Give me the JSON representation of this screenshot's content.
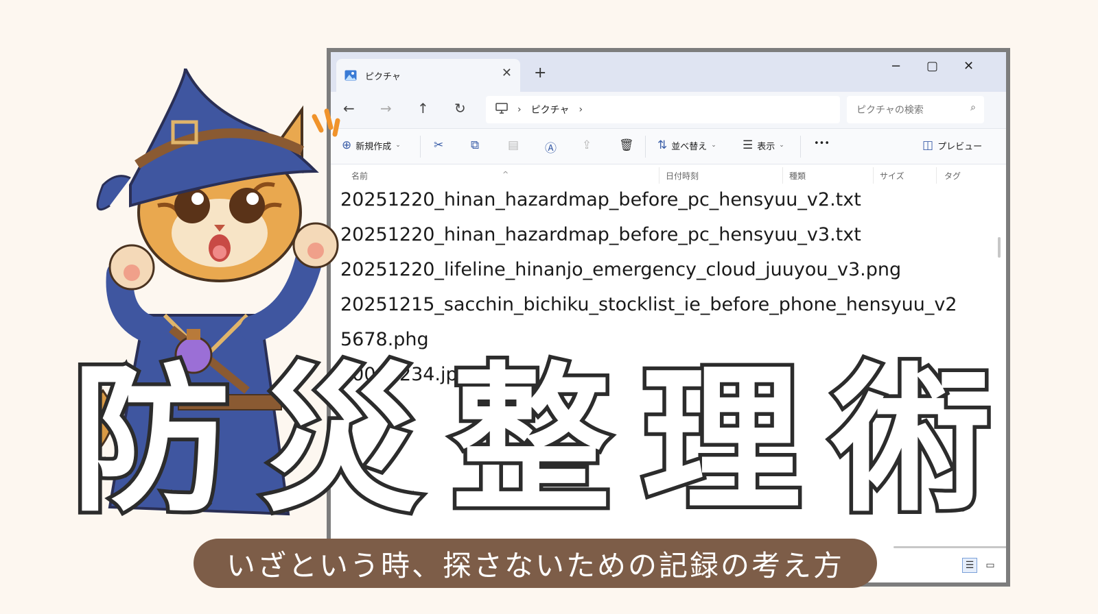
{
  "colors": {
    "background": "#fdf7f0",
    "window_frame": "#7d7d7d",
    "pill": "#7d5d48",
    "title_stroke": "#2c2c2c",
    "accent": "#3b5ea8"
  },
  "explorer": {
    "tab": {
      "label": "ピクチャ",
      "icon": "pictures-icon"
    },
    "window_buttons": {
      "minimize": "−",
      "maximize": "▢",
      "close": "✕"
    },
    "nav": {
      "back": "←",
      "forward": "→",
      "up": "↑",
      "refresh": "↻"
    },
    "address": {
      "crumb": "ピクチャ"
    },
    "search": {
      "placeholder": "ピクチャの検索"
    },
    "toolbar": {
      "new_label": "新規作成",
      "sort_label": "並べ替え",
      "view_label": "表示",
      "more_label": "•••",
      "preview_label": "プレビュー"
    },
    "columns": [
      "名前",
      "日付時刻",
      "種類",
      "サイズ",
      "タグ"
    ],
    "files": [
      "20251220_hinan_hazardmap_before_pc_hensyuu_v2.txt",
      "20251220_hinan_hazardmap_before_pc_hensyuu_v3.txt",
      "20251220_lifeline_hinanjo_emergency_cloud_juuyou_v3.png",
      "20251215_sacchin_bichiku_stocklist_ie_before_phone_hensyuu_v2",
      "5678.phg",
      "00001234.jpg"
    ]
  },
  "title": {
    "chars": [
      "防",
      "災",
      "整",
      "理",
      "術"
    ]
  },
  "subtitle": "いざという時、探さないための記録の考え方"
}
